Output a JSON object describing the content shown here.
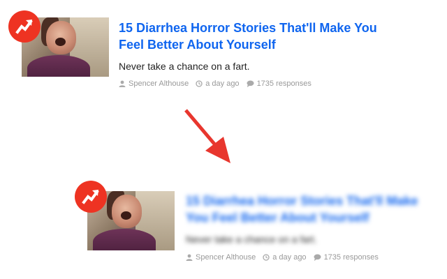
{
  "colors": {
    "title": "#0f65ef",
    "badge": "#ee3322",
    "arrow": "#e8362e",
    "meta": "#999999"
  },
  "badge_icon": "trending-arrow-icon",
  "article_top": {
    "title": "15 Diarrhea Horror Stories That'll Make You Feel Better About Yourself",
    "description": "Never take a chance on a fart.",
    "author": "Spencer Althouse",
    "time": "a day ago",
    "responses": "1735 responses"
  },
  "article_bottom": {
    "title": "15 Diarrhea Horror Stories That'll Make You Feel Better About Yourself",
    "description": "Never take a chance on a fart.",
    "author": "Spencer Althouse",
    "time": "a day ago",
    "responses": "1735 responses"
  },
  "arrow_icon": "down-right-arrow-icon"
}
